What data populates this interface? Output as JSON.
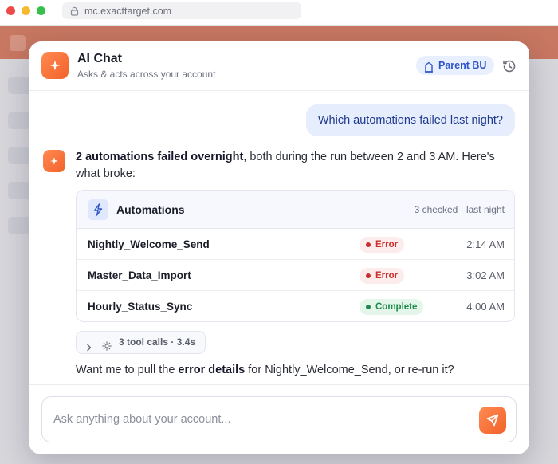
{
  "browser": {
    "url": "mc.exacttarget.com"
  },
  "header": {
    "title": "AI Chat",
    "subtitle": "Asks & acts across your account",
    "bu_label": "Parent BU"
  },
  "conversation": {
    "user_message": "Which automations failed last night?",
    "assistant_bold": "2 automations failed overnight",
    "assistant_text": ", both during the run between 2 and 3 AM. Here's what broke:",
    "card": {
      "title": "Automations",
      "meta": "3 checked · last night",
      "rows": [
        {
          "name": "Nightly_Welcome_Send",
          "status": "Error",
          "time": "2:14 AM"
        },
        {
          "name": "Master_Data_Import",
          "status": "Error",
          "time": "3:02 AM"
        },
        {
          "name": "Hourly_Status_Sync",
          "status": "Complete",
          "time": "4:00 AM"
        }
      ]
    },
    "tool_calls": "3 tool calls · 3.4s",
    "followup_pre": "Want me to pull the ",
    "followup_bold": "error details",
    "followup_post": " for Nightly_Welcome_Send, or re-run it?"
  },
  "composer": {
    "placeholder": "Ask anything about your account..."
  },
  "colors": {
    "accent": "#f26a32",
    "error": "#c9302c",
    "success": "#1f8a4c",
    "user_bubble": "#e6edfd"
  },
  "icons": {
    "logo": "sparkle-icon",
    "bu": "building-icon",
    "history": "history-icon",
    "card": "lightning-icon",
    "toolcalls": "gear-icon",
    "send": "send-icon"
  }
}
